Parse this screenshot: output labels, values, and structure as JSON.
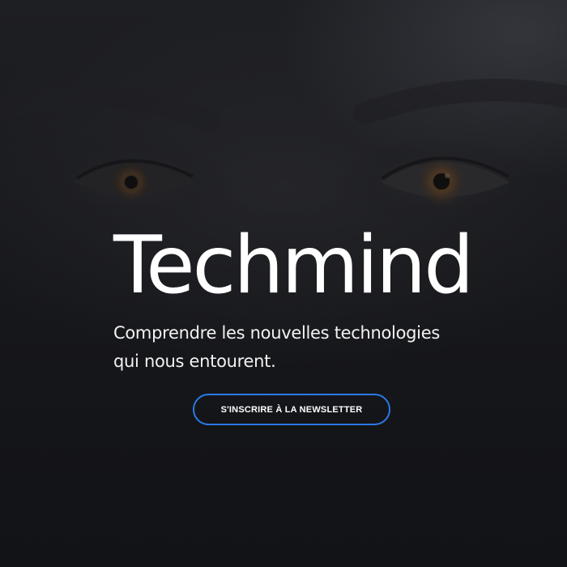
{
  "hero": {
    "title": "Techmind",
    "subtitle": "Comprendre les nouvelles technologies qui nous entourent.",
    "background_image": "face-eyes-photo",
    "cta_label": "S'INSCRIRE À LA NEWSLETTER"
  },
  "colors": {
    "background": "#141519",
    "text": "#ffffff",
    "cta_border": "#2b79e6"
  }
}
